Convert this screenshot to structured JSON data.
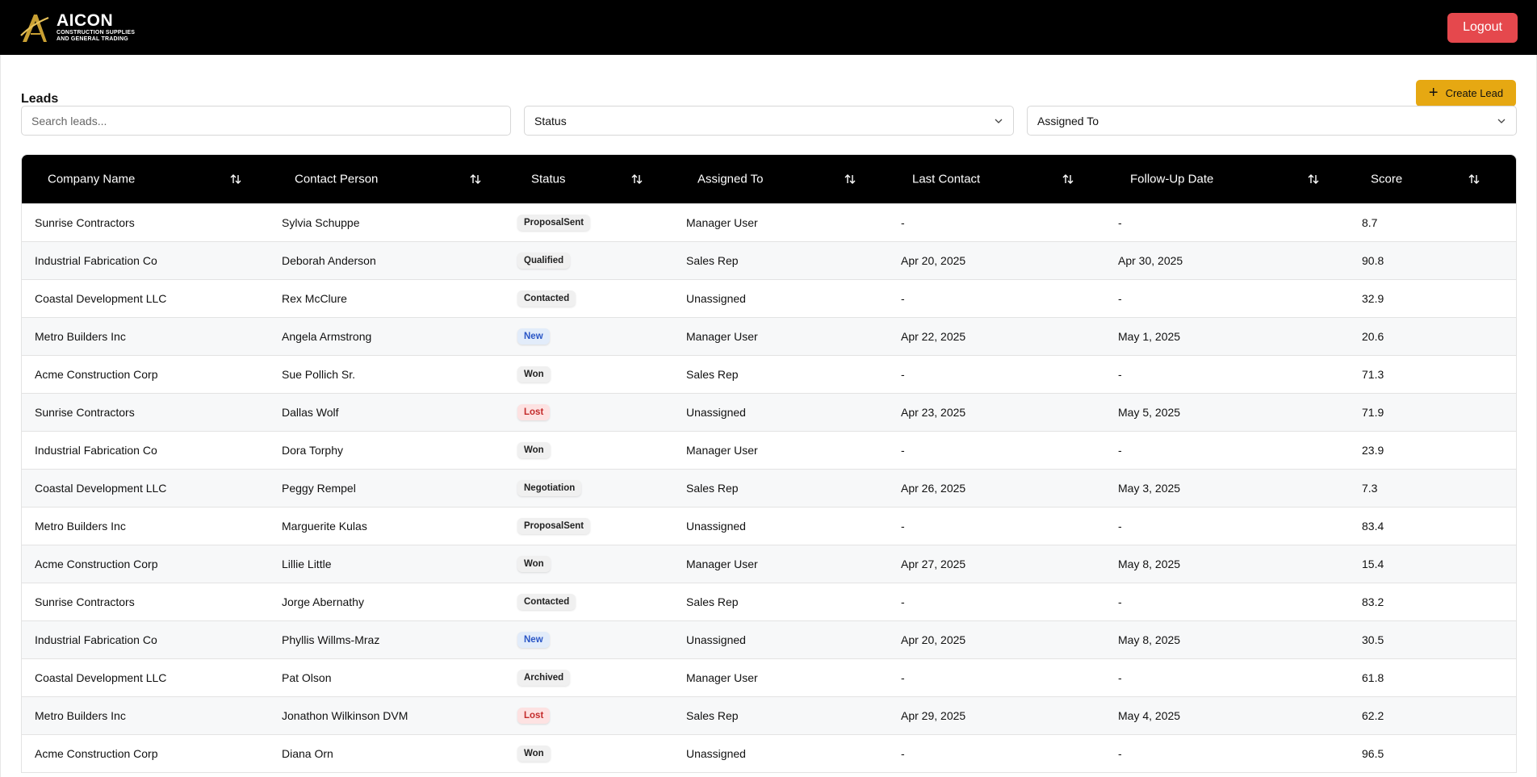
{
  "header": {
    "brand_name": "AICON",
    "brand_sub_1": "CONSTRUCTION SUPPLIES",
    "brand_sub_2": "AND GENERAL TRADING",
    "logout_label": "Logout"
  },
  "page": {
    "title": "Leads",
    "create_label": "Create Lead"
  },
  "filters": {
    "search_placeholder": "Search leads...",
    "status_label": "Status",
    "assigned_label": "Assigned To"
  },
  "table": {
    "columns": [
      "Company Name",
      "Contact Person",
      "Status",
      "Assigned To",
      "Last Contact",
      "Follow-Up Date",
      "Score"
    ],
    "rows": [
      {
        "company": "Sunrise Contractors",
        "contact": "Sylvia Schuppe",
        "status": "ProposalSent",
        "assigned": "Manager User",
        "last": "-",
        "follow": "-",
        "score": "8.7"
      },
      {
        "company": "Industrial Fabrication Co",
        "contact": "Deborah Anderson",
        "status": "Qualified",
        "assigned": "Sales Rep",
        "last": "Apr 20, 2025",
        "follow": "Apr 30, 2025",
        "score": "90.8"
      },
      {
        "company": "Coastal Development LLC",
        "contact": "Rex McClure",
        "status": "Contacted",
        "assigned": "Unassigned",
        "last": "-",
        "follow": "-",
        "score": "32.9"
      },
      {
        "company": "Metro Builders Inc",
        "contact": "Angela Armstrong",
        "status": "New",
        "assigned": "Manager User",
        "last": "Apr 22, 2025",
        "follow": "May 1, 2025",
        "score": "20.6"
      },
      {
        "company": "Acme Construction Corp",
        "contact": "Sue Pollich Sr.",
        "status": "Won",
        "assigned": "Sales Rep",
        "last": "-",
        "follow": "-",
        "score": "71.3"
      },
      {
        "company": "Sunrise Contractors",
        "contact": "Dallas Wolf",
        "status": "Lost",
        "assigned": "Unassigned",
        "last": "Apr 23, 2025",
        "follow": "May 5, 2025",
        "score": "71.9"
      },
      {
        "company": "Industrial Fabrication Co",
        "contact": "Dora Torphy",
        "status": "Won",
        "assigned": "Manager User",
        "last": "-",
        "follow": "-",
        "score": "23.9"
      },
      {
        "company": "Coastal Development LLC",
        "contact": "Peggy Rempel",
        "status": "Negotiation",
        "assigned": "Sales Rep",
        "last": "Apr 26, 2025",
        "follow": "May 3, 2025",
        "score": "7.3"
      },
      {
        "company": "Metro Builders Inc",
        "contact": "Marguerite Kulas",
        "status": "ProposalSent",
        "assigned": "Unassigned",
        "last": "-",
        "follow": "-",
        "score": "83.4"
      },
      {
        "company": "Acme Construction Corp",
        "contact": "Lillie Little",
        "status": "Won",
        "assigned": "Manager User",
        "last": "Apr 27, 2025",
        "follow": "May 8, 2025",
        "score": "15.4"
      },
      {
        "company": "Sunrise Contractors",
        "contact": "Jorge Abernathy",
        "status": "Contacted",
        "assigned": "Sales Rep",
        "last": "-",
        "follow": "-",
        "score": "83.2"
      },
      {
        "company": "Industrial Fabrication Co",
        "contact": "Phyllis Willms-Mraz",
        "status": "New",
        "assigned": "Unassigned",
        "last": "Apr 20, 2025",
        "follow": "May 8, 2025",
        "score": "30.5"
      },
      {
        "company": "Coastal Development LLC",
        "contact": "Pat Olson",
        "status": "Archived",
        "assigned": "Manager User",
        "last": "-",
        "follow": "-",
        "score": "61.8"
      },
      {
        "company": "Metro Builders Inc",
        "contact": "Jonathon Wilkinson DVM",
        "status": "Lost",
        "assigned": "Sales Rep",
        "last": "Apr 29, 2025",
        "follow": "May 4, 2025",
        "score": "62.2"
      },
      {
        "company": "Acme Construction Corp",
        "contact": "Diana Orn",
        "status": "Won",
        "assigned": "Unassigned",
        "last": "-",
        "follow": "-",
        "score": "96.5"
      }
    ]
  },
  "colors": {
    "topbar": "#000000",
    "logout": "#e5484d",
    "accent": "#e6a812",
    "badge_new_bg": "#e2ecfa",
    "badge_lost_bg": "#fde2e2"
  },
  "icons": {
    "logo": "aicon-logo-icon",
    "plus": "plus-icon",
    "chevron": "chevron-down-icon",
    "sort": "sort-arrows-icon"
  }
}
